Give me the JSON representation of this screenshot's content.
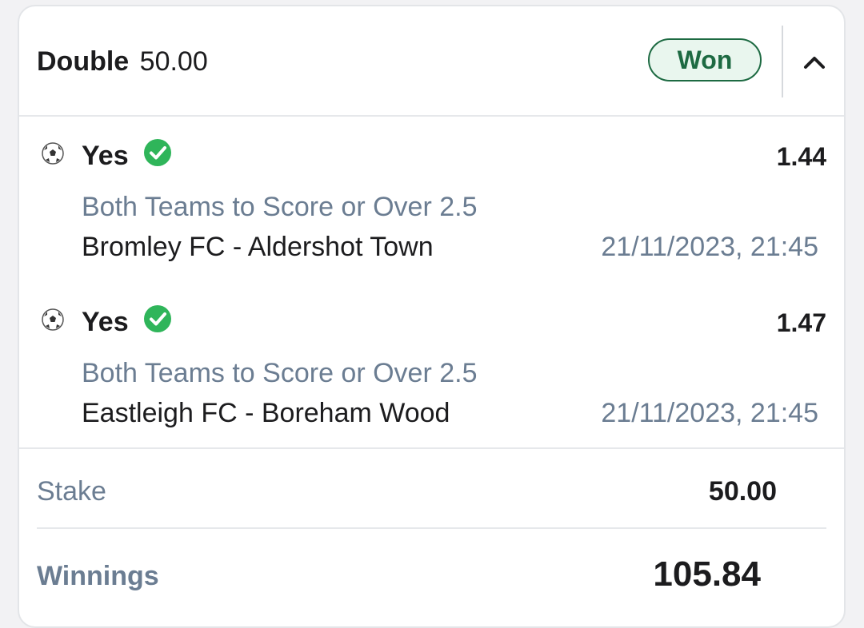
{
  "header": {
    "bet_type": "Double",
    "bet_amount": "50.00",
    "status": "Won"
  },
  "selections": [
    {
      "outcome": "Yes",
      "odds": "1.44",
      "market": "Both Teams to Score or Over 2.5",
      "event": "Bromley FC - Aldershot Town",
      "datetime": "21/11/2023, 21:45",
      "icon": "soccer-ball-icon",
      "status_icon": "check-circle-icon"
    },
    {
      "outcome": "Yes",
      "odds": "1.47",
      "market": "Both Teams to Score or Over 2.5",
      "event": "Eastleigh FC - Boreham Wood",
      "datetime": "21/11/2023, 21:45",
      "icon": "soccer-ball-icon",
      "status_icon": "check-circle-icon"
    }
  ],
  "summary": {
    "stake_label": "Stake",
    "stake_value": "50.00",
    "winnings_label": "Winnings",
    "winnings_value": "105.84"
  },
  "colors": {
    "won_green": "#1d6a42",
    "check_green": "#2fb55a",
    "muted_text": "#6b7d92"
  }
}
